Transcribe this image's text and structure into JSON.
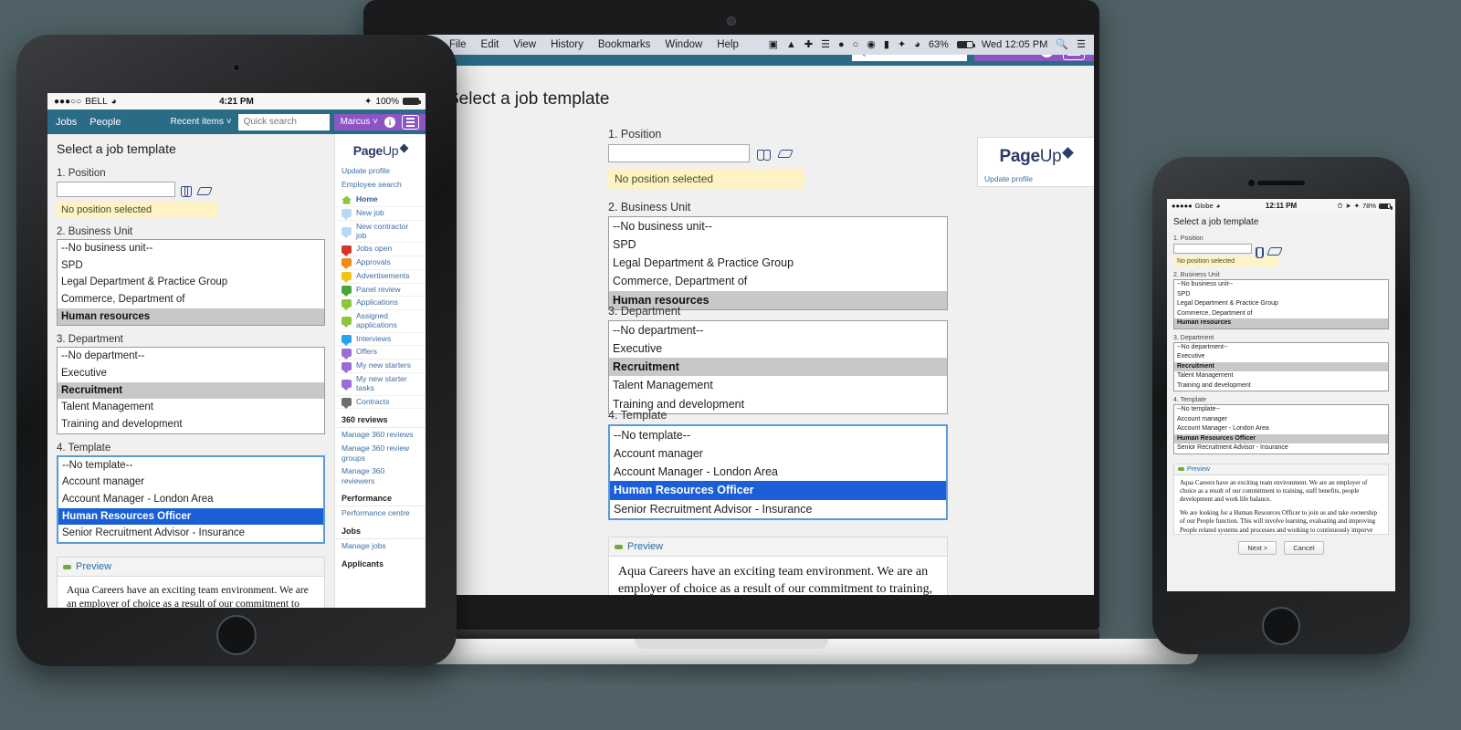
{
  "background_color": "#4f6166",
  "brand": {
    "name_page": "Page",
    "name_up": "Up",
    "logo_color": "#2b3a66"
  },
  "colors": {
    "appbar_teal": "#2a6b85",
    "appbar_purple": "#8c55c4",
    "selected_blue": "#1a5fd8",
    "selected_gray": "#c8c8c8",
    "highlight_yellow": "#fdf3c4",
    "link_blue": "#3b6ea5"
  },
  "mac_menubar": {
    "menus": [
      "File",
      "Edit",
      "View",
      "History",
      "Bookmarks",
      "Window",
      "Help"
    ],
    "status_icons": [
      "dropbox-icon",
      "drive-icon",
      "health-icon",
      "airplay-icon",
      "sync-icon",
      "timemachine-icon",
      "dropdown-icon",
      "keyboard-icon",
      "bluetooth-icon",
      "wifi-icon"
    ],
    "battery_percent": "63%",
    "clock": "Wed 12:05 PM",
    "search_icon": "search-icon",
    "notifications_icon": "notification-center-icon"
  },
  "appbar": {
    "nav": [
      "Jobs",
      "People"
    ],
    "recent_items": "Recent items",
    "chevron": "˅",
    "quick_search_placeholder": "Quick search",
    "quick_search_value": "",
    "user": "Marcus",
    "info_glyph": "i",
    "menu_icon": "hamburger-menu-icon"
  },
  "page": {
    "title": "Select a job template",
    "title_truncated": "b template",
    "position": {
      "label": "1. Position",
      "value": "",
      "search_icon": "binoculars-search-icon",
      "clear_icon": "eraser-clear-icon",
      "status": "No position selected"
    },
    "business_unit": {
      "label": "2. Business Unit",
      "options": [
        "--No business unit--",
        "SPD",
        "Legal Department & Practice Group",
        "Commerce, Department of",
        "Human resources"
      ],
      "selected": "Human resources"
    },
    "department": {
      "label": "3. Department",
      "options": [
        "--No department--",
        "Executive",
        "Recruitment",
        "Talent Management",
        "Training and development"
      ],
      "selected": "Recruitment"
    },
    "template": {
      "label": "4. Template",
      "options": [
        "--No template--",
        "Account manager",
        "Account Manager - London Area",
        "Human Resources Officer",
        "Senior Recruitment Advisor - Insurance"
      ],
      "selected": "Human Resources Officer"
    },
    "preview": {
      "label": "Preview",
      "toggle_icon": "collapse-minus-icon",
      "paragraph1": "Aqua Careers have an exciting team environment. We are an employer of choice as a result of our commitment to training, staff benefits, people development and work life balance.",
      "paragraph2": "We are looking for a Human Resources Officer to join us and take ownership of our People function. This will involve learning, evaluating and improving People related systems and processes and working to continuously imporve them."
    },
    "footer_buttons": {
      "next": "Next >",
      "cancel": "Cancel"
    }
  },
  "sidebar": {
    "top_links": [
      "Update profile",
      "Employee search"
    ],
    "home": {
      "label": "Home",
      "icon": "home-icon"
    },
    "items": [
      {
        "label": "New job",
        "icon": "new-job-icon",
        "color": "#b9d9f2"
      },
      {
        "label": "New contractor job",
        "icon": "new-contractor-job-icon",
        "color": "#b9d9f2"
      },
      {
        "label": "Jobs open",
        "icon": "jobs-open-icon",
        "color": "#d8352a"
      },
      {
        "label": "Approvals",
        "icon": "approvals-icon",
        "color": "#f08a1e"
      },
      {
        "label": "Advertisements",
        "icon": "advertisements-icon",
        "color": "#f0c419"
      },
      {
        "label": "Panel review",
        "icon": "panel-review-icon",
        "color": "#4aa33d"
      },
      {
        "label": "Applications",
        "icon": "applications-icon",
        "color": "#8cc63f"
      },
      {
        "label": "Assigned applications",
        "icon": "assigned-applications-icon",
        "color": "#8cc63f"
      },
      {
        "label": "Interviews",
        "icon": "interviews-icon",
        "color": "#29a3e8"
      },
      {
        "label": "Offers",
        "icon": "offers-icon",
        "color": "#9b6bd6"
      },
      {
        "label": "My new starters",
        "icon": "my-new-starters-icon",
        "color": "#9b6bd6"
      },
      {
        "label": "My new starter tasks",
        "icon": "my-new-starter-tasks-icon",
        "color": "#9b6bd6"
      },
      {
        "label": "Contracts",
        "icon": "contracts-icon",
        "color": "#6e6e6e"
      }
    ],
    "sections": [
      {
        "heading": "360 reviews",
        "links": [
          "Manage 360 reviews",
          "Manage 360 review groups",
          "Manage 360 reviewers"
        ]
      },
      {
        "heading": "Performance",
        "links": [
          "Performance centre"
        ]
      },
      {
        "heading": "Jobs",
        "links": [
          "Manage jobs"
        ]
      },
      {
        "heading": "Applicants",
        "links": []
      }
    ]
  },
  "tablet_status": {
    "carrier_dots": "●●●○○",
    "carrier": "BELL",
    "wifi_icon": "wifi-icon",
    "time": "4:21 PM",
    "bluetooth_icon": "bluetooth-icon",
    "battery_percent": "100%"
  },
  "phone_status": {
    "carrier_dots": "●●●●●",
    "carrier": "Globe",
    "wifi_icon": "wifi-icon",
    "time": "12:11 PM",
    "icons": [
      "alarm-icon",
      "location-icon",
      "bluetooth-icon"
    ],
    "battery_percent": "78%"
  }
}
